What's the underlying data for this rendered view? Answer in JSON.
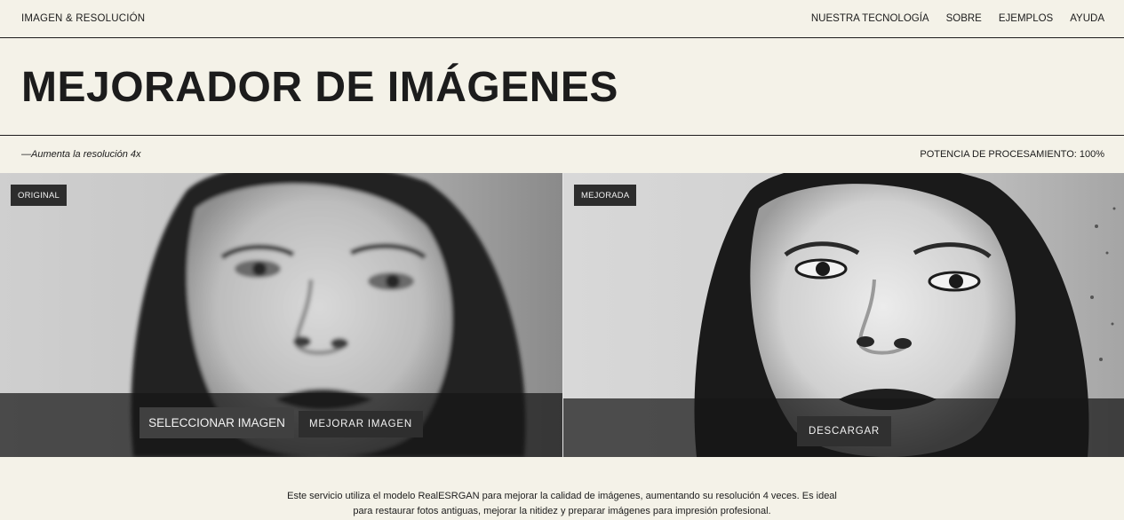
{
  "header": {
    "brand": "IMAGEN & RESOLUCIÓN",
    "nav": [
      "NUESTRA TECNOLOGÍA",
      "SOBRE",
      "EJEMPLOS",
      "AYUDA"
    ]
  },
  "hero": {
    "title": "MEJORADOR DE IMÁGENES"
  },
  "subbar": {
    "tagline": "—Aumenta la resolución 4x",
    "power": "POTENCIA DE PROCESAMIENTO: 100%"
  },
  "panels": {
    "original": {
      "tag": "ORIGINAL",
      "select_button": "SELECCIONAR IMAGEN",
      "enhance_button": "MEJORAR IMAGEN"
    },
    "enhanced": {
      "tag": "MEJORADA",
      "download_button": "DESCARGAR"
    }
  },
  "footer": {
    "description": "Este servicio utiliza el modelo RealESRGAN para mejorar la calidad de imágenes, aumentando su resolución 4 veces. Es ideal para restaurar fotos antiguas, mejorar la nitidez y preparar imágenes para impresión profesional."
  },
  "colors": {
    "background": "#f4f2e8",
    "text": "#1c1c1c",
    "tag_bg": "#2d2d2d"
  }
}
